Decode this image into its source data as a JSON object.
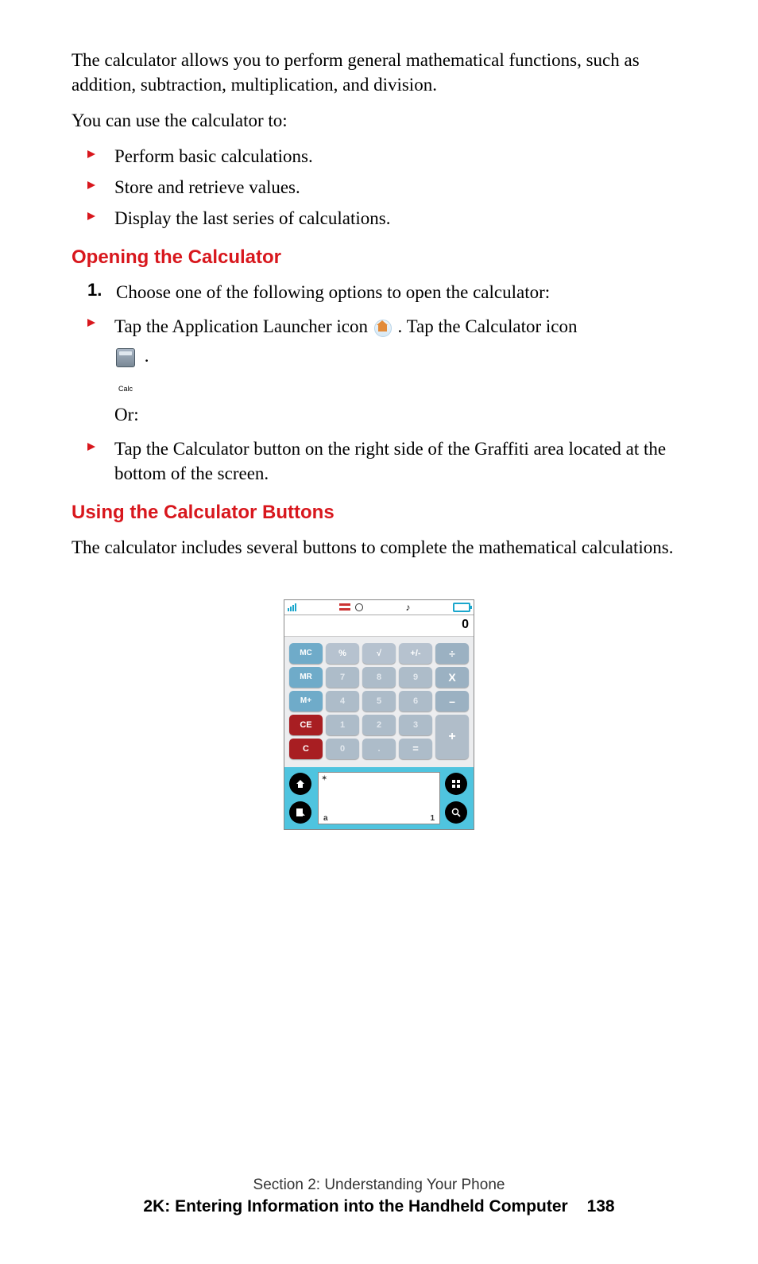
{
  "intro_para": "The calculator allows you to perform general mathematical functions, such as addition, subtraction, multiplication, and division.",
  "uses_lead": "You can use the calculator to:",
  "uses": [
    "Perform basic calculations.",
    "Store and retrieve values.",
    "Display the last series of calculations."
  ],
  "heading1": "Opening the Calculator",
  "step1_num": "1.",
  "step1_text": "Choose one of the following options to open the calculator:",
  "open_bullet1_pre": "Tap the Application Launcher icon ",
  "open_bullet1_mid": ". Tap the Calculator icon ",
  "open_bullet1_post": ".",
  "open_calc_label": "Calc",
  "or_text": "Or:",
  "open_bullet2": "Tap the Calculator button on the right side of the Graffiti area located at the bottom of the screen.",
  "heading2": "Using the Calculator Buttons",
  "using_para": "The calculator includes several buttons to complete the mathematical calculations.",
  "calc": {
    "display": "0",
    "buttons": {
      "mc": "MC",
      "pct": "%",
      "sqrt": "√",
      "pm": "+/-",
      "div": "÷",
      "mr": "MR",
      "7": "7",
      "8": "8",
      "9": "9",
      "mul": "X",
      "mplus": "M+",
      "4": "4",
      "5": "5",
      "6": "6",
      "sub": "–",
      "ce": "CE",
      "1": "1",
      "2": "2",
      "3": "3",
      "plus": "+",
      "c": "C",
      "0": "0",
      "dot": ".",
      "eq": "="
    },
    "graffiti": {
      "star": "✶",
      "a": "a",
      "one": "1"
    }
  },
  "footer": {
    "line1": "Section 2: Understanding Your Phone",
    "line2": "2K: Entering Information into the Handheld Computer",
    "page": "138"
  }
}
